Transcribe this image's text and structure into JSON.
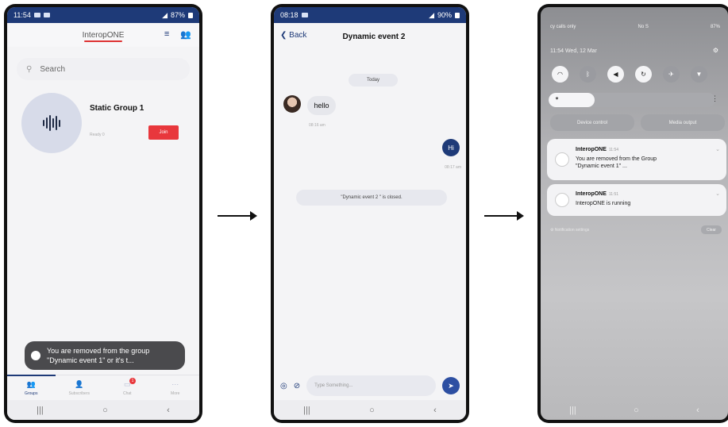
{
  "phone1": {
    "status_time": "11:54",
    "status_right": "87%",
    "logo": "InteropONE",
    "search_placeholder": "Search",
    "group_name": "Static Group 1",
    "group_sub": "Ready 0",
    "join_label": "Join",
    "toast": "You are removed from the group \"Dynamic event 1\" or it's t...",
    "nav": [
      "Groups",
      "Subscribers",
      "Chat",
      "More"
    ],
    "chat_badge": "1"
  },
  "phone2": {
    "status_time": "08:18",
    "status_right": "90%",
    "back_label": "Back",
    "title": "Dynamic event 2",
    "date_pill": "Today",
    "msg_in": "hello",
    "msg_in_time": "08:16 am",
    "msg_out": "Hi",
    "msg_out_time": "08:17 am",
    "closed_notice": "\"Dynamic event 2 \" is closed.",
    "composer_placeholder": "Type Something..."
  },
  "phone3": {
    "top_left": "cy calls only",
    "top_mid": "No S",
    "top_right": "87%",
    "date": "11:54  Wed, 12 Mar",
    "device_control": "Device control",
    "media_output": "Media output",
    "notif1_title": "InteropONE",
    "notif1_time": "11:54",
    "notif1_body_line1": "You are removed from the Group",
    "notif1_body_line2": "\"Dynamic event 1\" ...",
    "notif2_title": "InteropONE",
    "notif2_time": "11:51",
    "notif2_body": "InteropONE is running",
    "notif_settings": "Notification settings",
    "clear": "Clear"
  },
  "icons": {
    "menu": "filter-lines-icon",
    "users": "users-icon",
    "search": "search-icon",
    "audio": "audio-wave-icon",
    "back": "chevron-left-icon",
    "send": "send-icon",
    "attach": "paperclip-icon",
    "location": "location-icon",
    "wifi": "wifi-icon",
    "bluetooth": "bluetooth-icon",
    "sound": "speaker-icon",
    "rotate": "auto-rotate-icon",
    "airplane": "airplane-icon",
    "flashlight": "flashlight-icon",
    "gear": "gear-icon"
  },
  "colors": {
    "brand": "#1e3a78",
    "join": "#e8373c",
    "send": "#2d4fa2"
  }
}
